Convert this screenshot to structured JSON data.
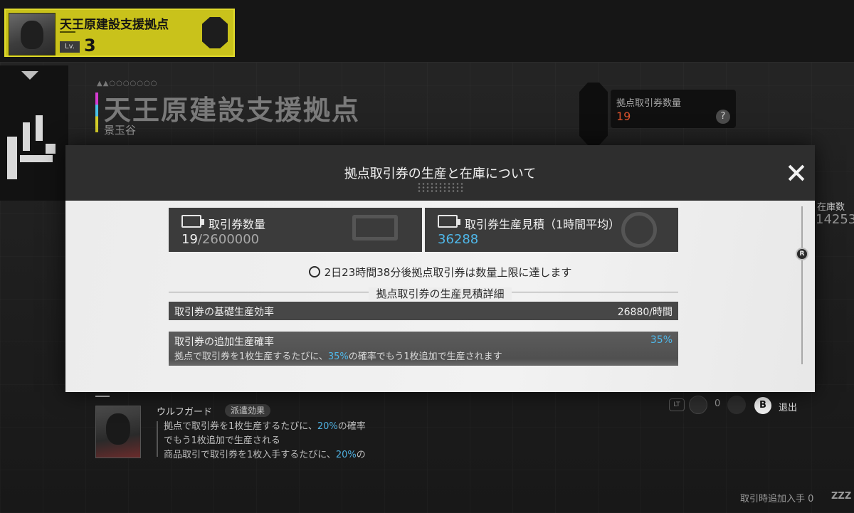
{
  "base": {
    "name": "天王原建設支援拠点",
    "level_label": "Lv.",
    "level": "3"
  },
  "background": {
    "title": "天王原建設支援拠点",
    "subtitle": "景玉谷",
    "voucher_count_label": "拠点取引券数量",
    "voucher_count": "19",
    "help_icon": "?",
    "right_peek_label": "在庫数",
    "right_peek_value": "14253"
  },
  "agent": {
    "name": "ウルフガード",
    "tag": "派遣効果",
    "line1_pre": "拠点で取引券を1枚生産するたびに、",
    "line1_pct": "20%",
    "line1_post": "の確率",
    "line2": "でもう1枚追加で生産される",
    "line3_pre": "商品取引で取引券を1枚入手するたびに、",
    "line3_pct": "20%",
    "line3_post": "の"
  },
  "controls": {
    "lt_label": "LT",
    "zero_value": "0",
    "b_button": "B",
    "exit_label": "退出"
  },
  "footer": {
    "extra_label": "取引時追加入手 0",
    "logo": "ZZZ"
  },
  "modal": {
    "title": "拠点取引券の生産と在庫について",
    "voucher_label": "取引券数量",
    "voucher_current": "19",
    "voucher_max": "/2600000",
    "production_label": "取引券生産見積（1時間平均）",
    "production_value": "36288",
    "notice": "2日23時間38分後拠点取引券は数量上限に達します",
    "section_title": "拠点取引券の生産見積詳細",
    "base_rate_label": "取引券の基礎生産効率",
    "base_rate_value": "26880/時間",
    "extra_chance_label": "取引券の追加生産確率",
    "extra_chance_value": "35%",
    "extra_desc_pre": "拠点で取引券を1枚生産するたびに、",
    "extra_desc_pct": "35%",
    "extra_desc_post": "の確率でもう1枚追加で生産されます",
    "scroll_knob": "R"
  },
  "colors": {
    "accent_yellow": "#c9c21b",
    "highlight_blue": "#4fb8ea",
    "count_orange": "#d8512c"
  }
}
